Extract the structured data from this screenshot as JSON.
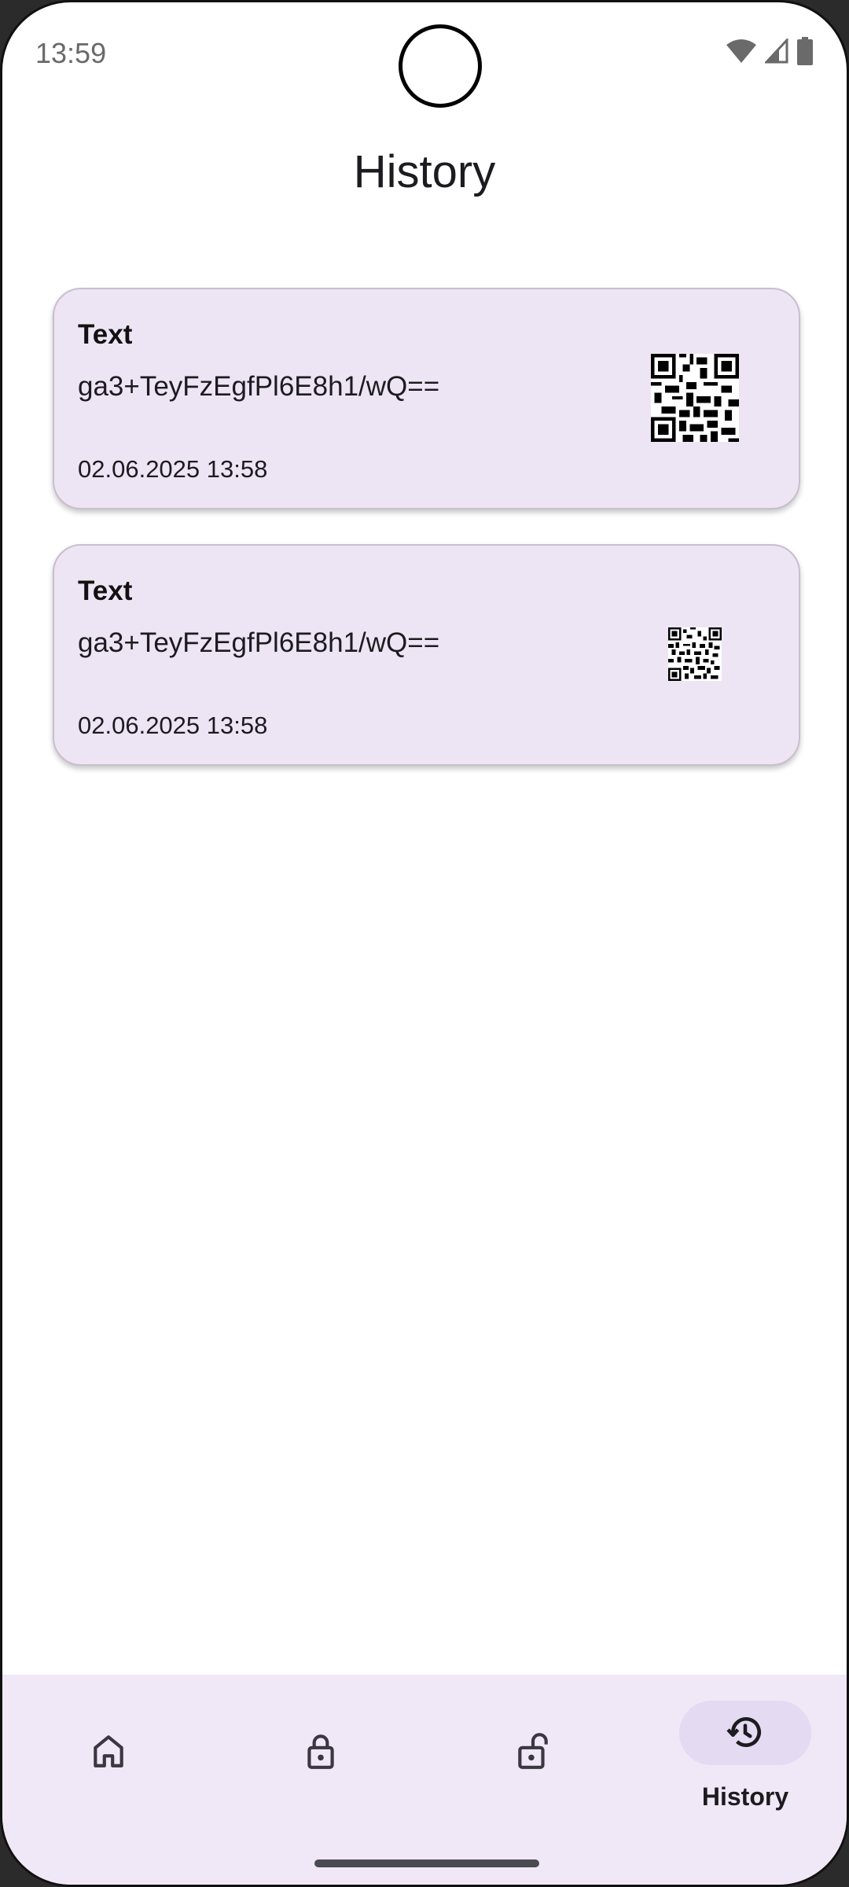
{
  "status_bar": {
    "time": "13:59",
    "icons": [
      "wifi-icon",
      "signal-icon",
      "battery-icon"
    ]
  },
  "page": {
    "title": "History"
  },
  "history": {
    "items": [
      {
        "type": "Text",
        "content": "ga3+TeyFzEgfPl6E8h1/wQ==",
        "date": "02.06.2025 13:58",
        "thumbnail": "qr-code-large"
      },
      {
        "type": "Text",
        "content": "ga3+TeyFzEgfPl6E8h1/wQ==",
        "date": "02.06.2025 13:58",
        "thumbnail": "qr-code-small"
      }
    ]
  },
  "bottom_nav": {
    "items": [
      {
        "icon": "home-icon",
        "label": "",
        "active": false
      },
      {
        "icon": "lock-icon",
        "label": "",
        "active": false
      },
      {
        "icon": "unlock-icon",
        "label": "",
        "active": false
      },
      {
        "icon": "history-icon",
        "label": "History",
        "active": true
      }
    ]
  },
  "colors": {
    "card_background": "#ede5f4",
    "nav_background": "#f0e8f6",
    "active_pill": "#e4daf2",
    "text_primary": "#1c1b1f"
  }
}
